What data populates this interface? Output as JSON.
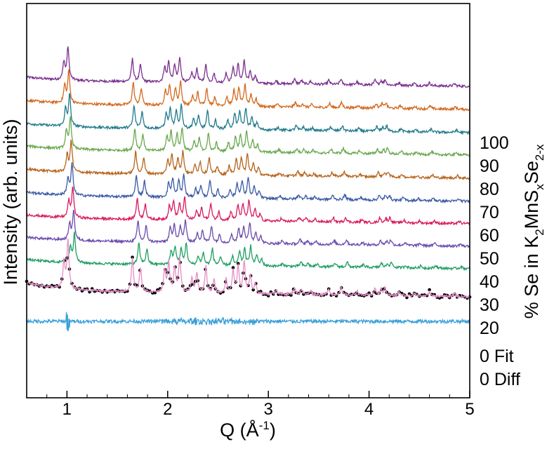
{
  "chart_data": {
    "type": "line",
    "xlabel": "Q (Å",
    "xlabel_sup": "-1",
    "xlabel_end": ")",
    "ylabel": "Intensity (arb. units)",
    "right_label": {
      "prefix": "% Se in K",
      "sub1": "2",
      "mid": "MnS",
      "sub2": "x",
      "se": "Se",
      "sub3": "2-x"
    },
    "xlim": [
      0.6,
      5.0
    ],
    "x_ticks": [
      1,
      2,
      3,
      4,
      5
    ],
    "x_tick_labels": [
      "1",
      "2",
      "3",
      "4",
      "5"
    ],
    "grid": false,
    "offset_traces": true,
    "series": [
      {
        "name": "100",
        "color": "#7b2f8e",
        "baseline": 1.95
      },
      {
        "name": "90",
        "color": "#d2691e",
        "baseline": 1.62
      },
      {
        "name": "80",
        "color": "#1f7a8c",
        "baseline": 1.29
      },
      {
        "name": "70",
        "color": "#6aa84f",
        "baseline": 0.97
      },
      {
        "name": "60",
        "color": "#b5651d",
        "baseline": 0.64
      },
      {
        "name": "50",
        "color": "#3c5aa6",
        "baseline": 0.31
      },
      {
        "name": "40",
        "color": "#d81b60",
        "baseline": -0.01
      },
      {
        "name": "30",
        "color": "#6a4bad",
        "baseline": -0.33
      },
      {
        "name": "20",
        "color": "#1e9e63",
        "baseline": -0.65
      },
      {
        "name": "0 Fit",
        "color": "#e58fc6",
        "baseline": -1.05
      },
      {
        "name": "0 Diff",
        "color": "#3aa0d8",
        "baseline": -1.48
      }
    ],
    "fit_points_color": "#000000",
    "peaks_Q": [
      0.97,
      1.01,
      1.65,
      1.73,
      1.97,
      2.01,
      2.07,
      2.12,
      2.24,
      2.29,
      2.38,
      2.46,
      2.58,
      2.65,
      2.7,
      2.76,
      2.82,
      2.87,
      3.08,
      3.26,
      3.33,
      3.42,
      3.6,
      3.72,
      3.88,
      4.06,
      4.12,
      4.16,
      4.3,
      4.45,
      4.6,
      4.85
    ]
  }
}
